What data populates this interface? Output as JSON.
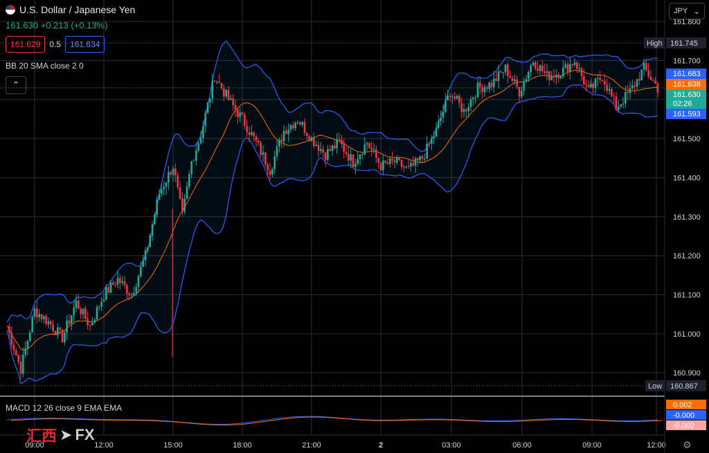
{
  "header": {
    "title": "U.S. Dollar / Japanese Yen",
    "change": "161.630 +0.213 (+0.13%)",
    "bid": "161.629",
    "spread": "0.5",
    "ask": "161.634"
  },
  "indicator": {
    "bb_label": "BB 20 SMA close 2 0",
    "macd_label": "MACD 12 26 close 9 EMA EMA"
  },
  "currency_selector": {
    "value": "JPY"
  },
  "logo": {
    "cn": "汇西",
    "fx": "FX"
  },
  "colors": {
    "up": "#22ab94",
    "down": "#f23645",
    "band": "#2962ff",
    "basis": "#ff6d00"
  },
  "chart_data": {
    "type": "candlestick",
    "yticks": [
      "161.800",
      "161.700",
      "161.600",
      "161.500",
      "161.400",
      "161.300",
      "161.200",
      "161.100",
      "161.000",
      "160.900"
    ],
    "ylim": [
      160.84,
      161.855
    ],
    "xticks": [
      "09:00",
      "12:00",
      "15:00",
      "18:00",
      "21:00",
      "2",
      "03:00",
      "06:00",
      "09:00",
      "12:00"
    ],
    "high": {
      "label": "High",
      "value": "161.745"
    },
    "low": {
      "label": "Low",
      "value": "160.867"
    },
    "price_labels": [
      {
        "value": "161.683",
        "kind": "upper"
      },
      {
        "value": "161.638",
        "kind": "basis"
      },
      {
        "value": "161.630",
        "kind": "last",
        "timer": "02:26"
      },
      {
        "value": "161.593",
        "kind": "lower"
      }
    ],
    "macd_labels": [
      "0.002",
      "-0.000",
      "-0.002"
    ],
    "close_path": [
      [
        0,
        161.02
      ],
      [
        6,
        160.91
      ],
      [
        12,
        161.06
      ],
      [
        18,
        161.03
      ],
      [
        24,
        160.99
      ],
      [
        30,
        161.08
      ],
      [
        36,
        161.02
      ],
      [
        42,
        161.1
      ],
      [
        48,
        161.14
      ],
      [
        54,
        161.1
      ],
      [
        60,
        161.2
      ],
      [
        66,
        161.36
      ],
      [
        72,
        161.43
      ],
      [
        76,
        161.3
      ],
      [
        80,
        161.44
      ],
      [
        84,
        161.51
      ],
      [
        90,
        161.66
      ],
      [
        96,
        161.6
      ],
      [
        102,
        161.55
      ],
      [
        108,
        161.49
      ],
      [
        114,
        161.42
      ],
      [
        120,
        161.52
      ],
      [
        126,
        161.55
      ],
      [
        132,
        161.5
      ],
      [
        138,
        161.46
      ],
      [
        144,
        161.49
      ],
      [
        150,
        161.44
      ],
      [
        156,
        161.49
      ],
      [
        162,
        161.43
      ],
      [
        168,
        161.44
      ],
      [
        174,
        161.42
      ],
      [
        180,
        161.45
      ],
      [
        186,
        161.52
      ],
      [
        192,
        161.62
      ],
      [
        198,
        161.57
      ],
      [
        204,
        161.63
      ],
      [
        210,
        161.64
      ],
      [
        216,
        161.68
      ],
      [
        222,
        161.62
      ],
      [
        228,
        161.7
      ],
      [
        234,
        161.66
      ],
      [
        240,
        161.67
      ],
      [
        246,
        161.7
      ],
      [
        252,
        161.62
      ],
      [
        258,
        161.66
      ],
      [
        264,
        161.58
      ],
      [
        270,
        161.62
      ],
      [
        276,
        161.68
      ],
      [
        282,
        161.63
      ]
    ],
    "x_max": 282
  }
}
